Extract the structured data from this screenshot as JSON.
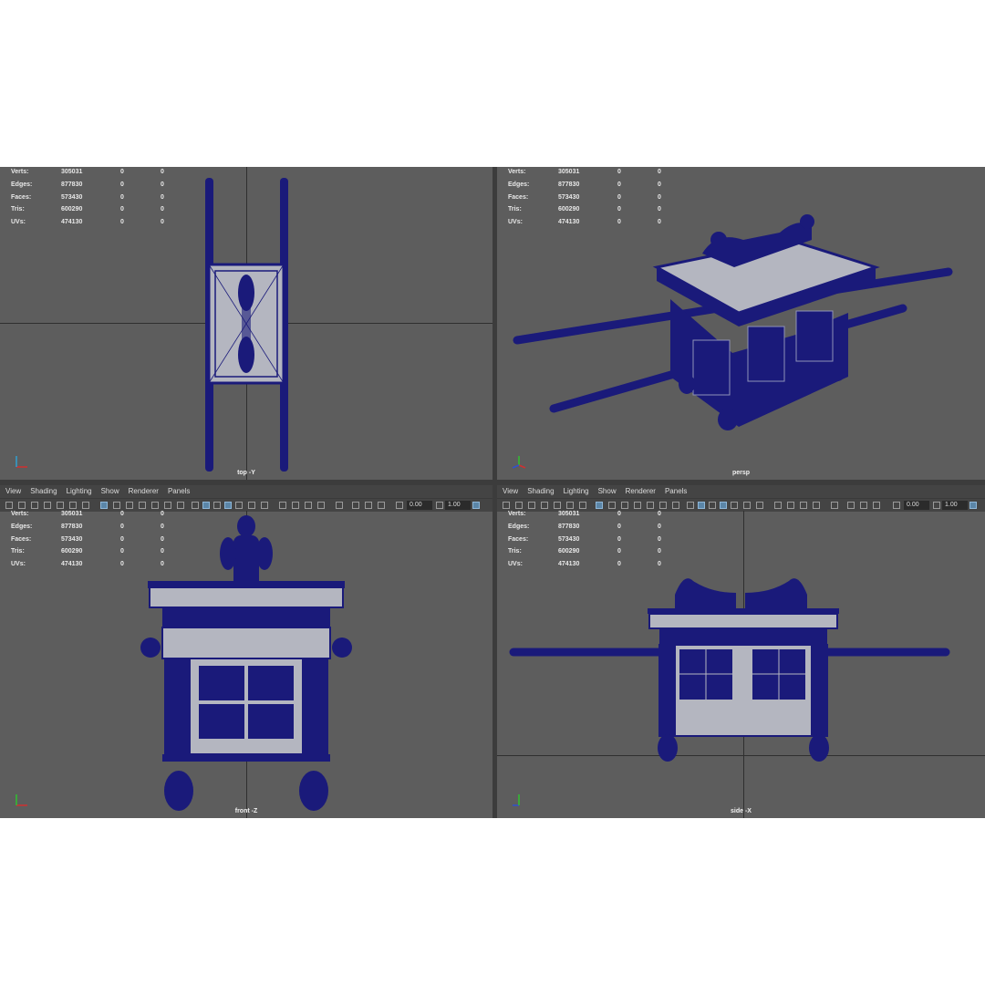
{
  "menu": [
    "View",
    "Shading",
    "Lighting",
    "Show",
    "Renderer",
    "Panels"
  ],
  "toolbar": {
    "exposure": "0.00",
    "gamma": "1.00"
  },
  "stats_labels": [
    "Verts:",
    "Edges:",
    "Faces:",
    "Tris:",
    "UVs:"
  ],
  "stats_values": [
    [
      "305031",
      "0",
      "0"
    ],
    [
      "877830",
      "0",
      "0"
    ],
    [
      "573430",
      "0",
      "0"
    ],
    [
      "600290",
      "0",
      "0"
    ],
    [
      "474130",
      "0",
      "0"
    ]
  ],
  "viewports": {
    "top": {
      "label": "top -Y"
    },
    "persp": {
      "label": "persp"
    },
    "front": {
      "label": "front -Z"
    },
    "side": {
      "label": "side -X"
    }
  },
  "colors": {
    "wire": "#1a1a7a",
    "surface": "#b4b6c0",
    "background": "#5d5d5d"
  }
}
